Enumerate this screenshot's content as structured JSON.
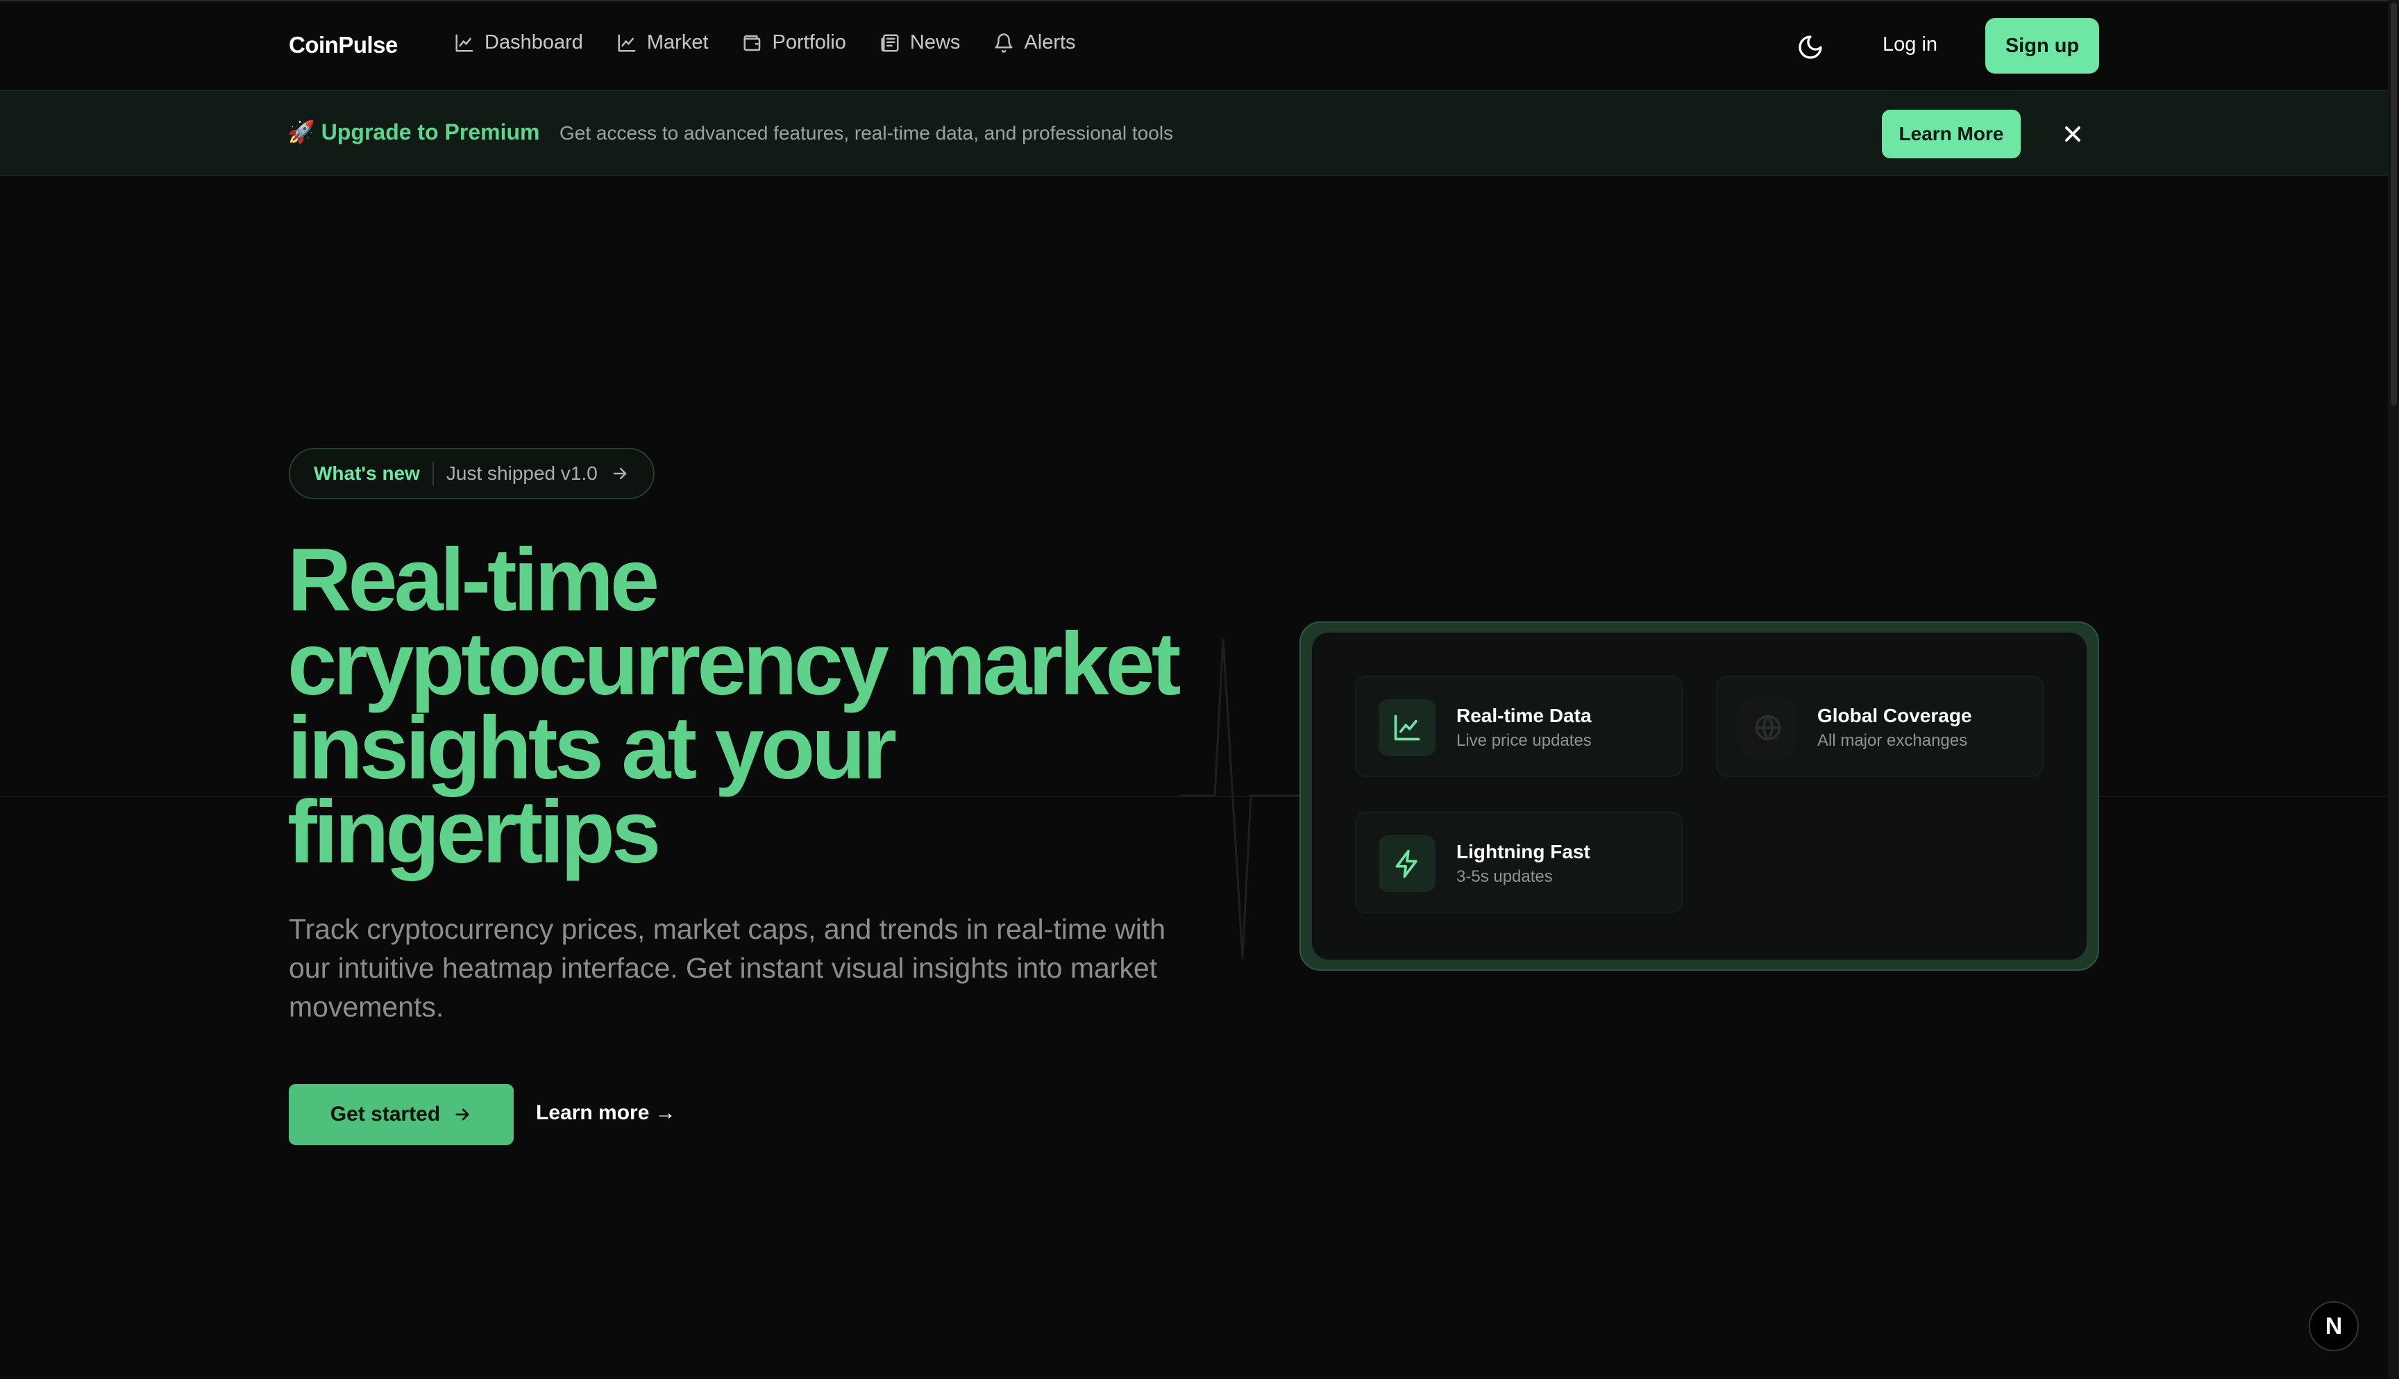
{
  "brand": "CoinPulse",
  "nav": [
    {
      "label": "Dashboard",
      "icon": "line-chart-icon"
    },
    {
      "label": "Market",
      "icon": "line-chart-icon"
    },
    {
      "label": "Portfolio",
      "icon": "wallet-icon"
    },
    {
      "label": "News",
      "icon": "newspaper-icon"
    },
    {
      "label": "Alerts",
      "icon": "bell-icon"
    }
  ],
  "header_actions": {
    "theme_icon": "moon-icon",
    "login": "Log in",
    "signup": "Sign up"
  },
  "promo": {
    "emoji": "🚀",
    "title": "Upgrade to Premium",
    "text": "Get access to advanced features, real-time data, and professional tools",
    "button": "Learn More",
    "close_icon": "close-icon"
  },
  "hero": {
    "badge_new": "What's new",
    "badge_ship": "Just shipped v1.0",
    "headline": [
      "Real-time",
      "cryptocurrency market",
      "insights at your",
      "fingertips"
    ],
    "subcopy": "Track cryptocurrency prices, market caps, and trends in real-time with our intuitive heatmap interface. Get instant visual insights into market movements.",
    "cta_primary": "Get started",
    "cta_secondary": "Learn more →"
  },
  "features": [
    {
      "title": "Real-time Data",
      "subtitle": "Live price updates",
      "icon": "line-chart-icon"
    },
    {
      "title": "Global Coverage",
      "subtitle": "All major exchanges",
      "icon": "globe-icon"
    },
    {
      "title": "Lightning Fast",
      "subtitle": "3-5s updates",
      "icon": "zap-icon"
    }
  ],
  "next_badge": "N",
  "colors": {
    "accent": "#6ee7a4",
    "headline": "#5ed18a",
    "background": "#0a0a0a",
    "banner": "#111b15"
  }
}
